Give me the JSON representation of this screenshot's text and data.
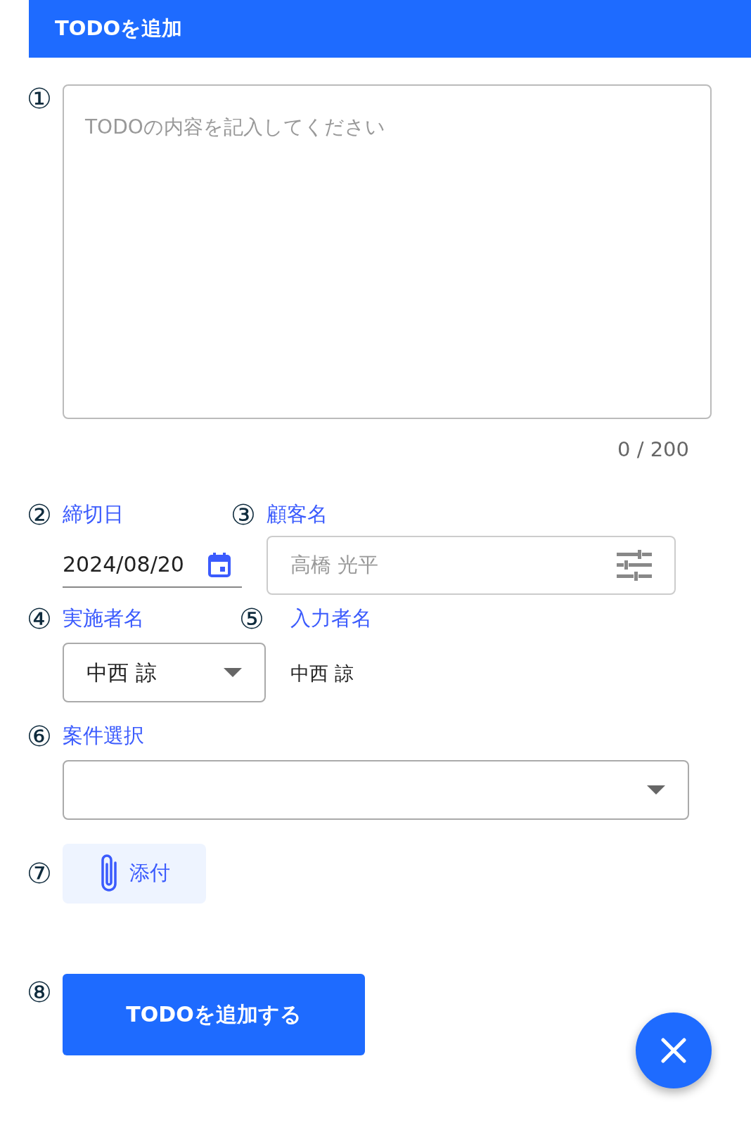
{
  "header": {
    "title": "TODOを追加"
  },
  "content": {
    "marker": "①",
    "placeholder": "TODOの内容を記入してください",
    "counter": "0 / 200"
  },
  "due_date": {
    "marker": "②",
    "label": "締切日",
    "value": "2024/08/20"
  },
  "customer": {
    "marker": "③",
    "label": "顧客名",
    "placeholder": "高橋 光平"
  },
  "assignee": {
    "marker": "④",
    "label": "実施者名",
    "value": "中西 諒"
  },
  "entered_by": {
    "marker": "⑤",
    "label": "入力者名",
    "value": "中西 諒"
  },
  "project": {
    "marker": "⑥",
    "label": "案件選択"
  },
  "attach": {
    "marker": "⑦",
    "label": "添付"
  },
  "submit": {
    "marker": "⑧",
    "label": "TODOを追加する"
  }
}
